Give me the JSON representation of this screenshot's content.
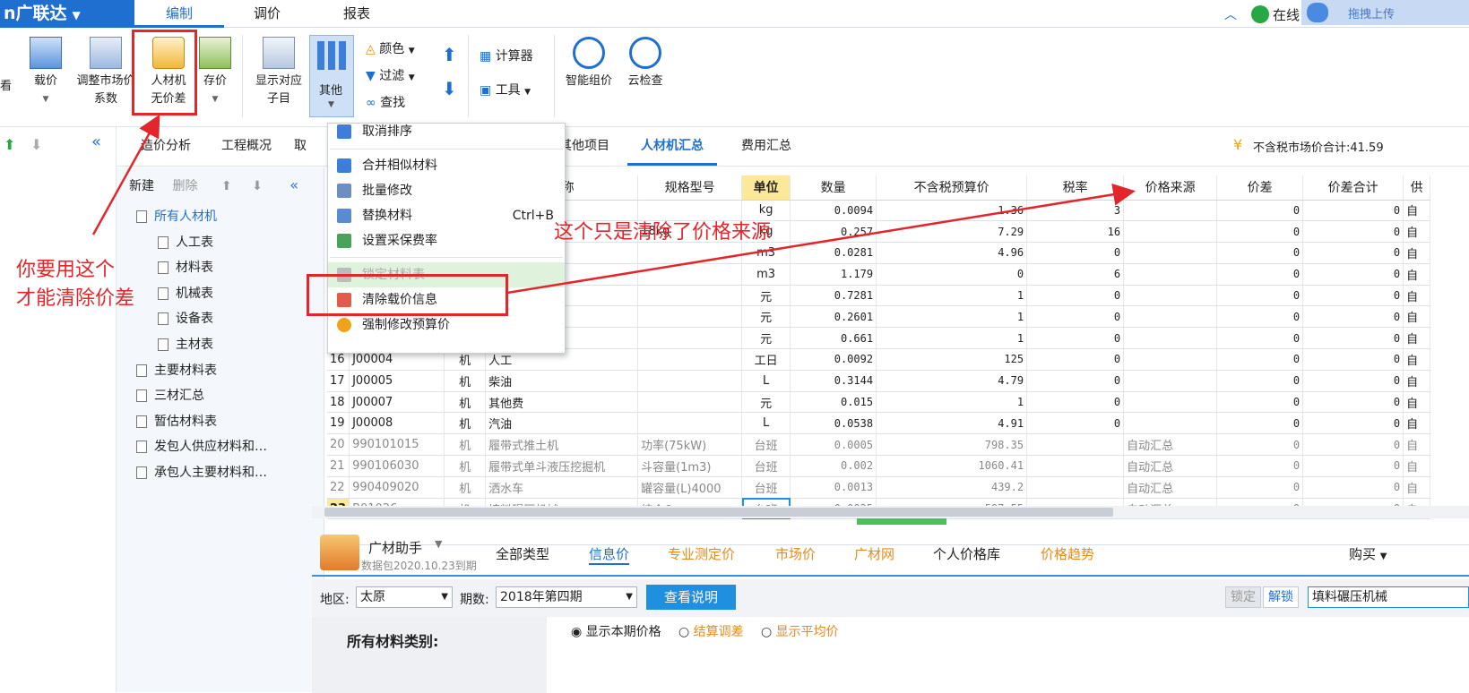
{
  "app": {
    "logo_text": "n广联达",
    "logo_caret": "▼"
  },
  "menu_tabs": [
    "编制",
    "调价",
    "报表"
  ],
  "top_right": {
    "status": "在线",
    "upload": "拖拽上传"
  },
  "ribbon": {
    "view_label": "看",
    "load_price": "载价",
    "adjust_market_line1": "调整市场价",
    "adjust_market_line2": "系数",
    "no_diff_line1": "人材机",
    "no_diff_line2": "无价差",
    "save_price": "存价",
    "show_sub_line1": "显示对应",
    "show_sub_line2": "子目",
    "other": "其他",
    "color": "颜色",
    "filter": "过滤",
    "find": "查找",
    "calculator": "计算器",
    "tools": "工具",
    "smart_price": "智能组价",
    "cloud_check": "云检查"
  },
  "subtabs": [
    "造价分析",
    "工程概况",
    "取",
    "其他项目",
    "人材机汇总",
    "费用汇总"
  ],
  "market_total": "不含税市场价合计:41.59",
  "tree": {
    "new": "新建",
    "delete": "删除",
    "items": [
      {
        "label": "所有人材机",
        "level": 0
      },
      {
        "label": "人工表",
        "level": 1
      },
      {
        "label": "材料表",
        "level": 1
      },
      {
        "label": "机械表",
        "level": 1
      },
      {
        "label": "设备表",
        "level": 1
      },
      {
        "label": "主材表",
        "level": 1
      },
      {
        "label": "主要材料表",
        "level": 0
      },
      {
        "label": "三材汇总",
        "level": 0
      },
      {
        "label": "暂估材料表",
        "level": 0
      },
      {
        "label": "发包人供应材料和…",
        "level": 0
      },
      {
        "label": "承包人主要材料和…",
        "level": 0
      }
    ]
  },
  "grid": {
    "headers": [
      "",
      "编码",
      "类别",
      "名称",
      "规格型号",
      "单位",
      "数量",
      "不含税预算价",
      "税率",
      "价格来源",
      "价差",
      "价差合计",
      "供"
    ],
    "rows": [
      [
        "",
        "",
        "",
        "",
        "",
        "kg",
        "0.0094",
        "1.36",
        "3",
        "",
        "0",
        "0",
        "自"
      ],
      [
        "",
        "",
        "",
        "",
        "18kg",
        "kg",
        "0.257",
        "7.29",
        "16",
        "",
        "0",
        "0",
        "自"
      ],
      [
        "",
        "",
        "",
        "",
        "",
        "m3",
        "0.0281",
        "4.96",
        "0",
        "",
        "0",
        "0",
        "自"
      ],
      [
        "",
        "",
        "",
        "",
        "",
        "m3",
        "1.179",
        "0",
        "6",
        "",
        "0",
        "0",
        "自"
      ],
      [
        "",
        "",
        "",
        "",
        "",
        "元",
        "0.7281",
        "1",
        "0",
        "",
        "0",
        "0",
        "自"
      ],
      [
        "",
        "",
        "",
        "",
        "",
        "元",
        "0.2601",
        "1",
        "0",
        "",
        "0",
        "0",
        "自"
      ],
      [
        "",
        "",
        "",
        "",
        "",
        "元",
        "0.661",
        "1",
        "0",
        "",
        "0",
        "0",
        "自"
      ],
      [
        "16",
        "J00004",
        "机",
        "人工",
        "",
        "工日",
        "0.0092",
        "125",
        "0",
        "",
        "0",
        "0",
        "自"
      ],
      [
        "17",
        "J00005",
        "机",
        "柴油",
        "",
        "L",
        "0.3144",
        "4.79",
        "0",
        "",
        "0",
        "0",
        "自"
      ],
      [
        "18",
        "J00007",
        "机",
        "其他费",
        "",
        "元",
        "0.015",
        "1",
        "0",
        "",
        "0",
        "0",
        "自"
      ],
      [
        "19",
        "J00008",
        "机",
        "汽油",
        "",
        "L",
        "0.0538",
        "4.91",
        "0",
        "",
        "0",
        "0",
        "自"
      ],
      [
        "20",
        "990101015",
        "机",
        "履带式推土机",
        "功率(75kW)",
        "台班",
        "0.0005",
        "798.35",
        "",
        "自动汇总",
        "0",
        "0",
        "自"
      ],
      [
        "21",
        "990106030",
        "机",
        "履带式单斗液压挖掘机",
        "斗容量(1m3)",
        "台班",
        "0.002",
        "1060.41",
        "",
        "自动汇总",
        "0",
        "0",
        "自"
      ],
      [
        "22",
        "990409020",
        "机",
        "洒水车",
        "罐容量(L)4000",
        "台班",
        "0.0013",
        "439.2",
        "",
        "自动汇总",
        "0",
        "0",
        "自"
      ],
      [
        "23",
        "B01026",
        "机",
        "填料碾压机械",
        "综合6",
        "台班",
        "0.0025",
        "597.55",
        "",
        "自动汇总",
        "0",
        "0",
        "自"
      ]
    ]
  },
  "dropdown": {
    "items": [
      {
        "label": "取消排序",
        "shortcut": ""
      },
      {
        "label": "合并相似材料",
        "shortcut": ""
      },
      {
        "label": "批量修改",
        "shortcut": ""
      },
      {
        "label": "替换材料",
        "shortcut": "Ctrl+B"
      },
      {
        "label": "设置采保费率",
        "shortcut": ""
      },
      {
        "label": "锁定材料表",
        "shortcut": ""
      },
      {
        "label": "清除载价信息",
        "shortcut": ""
      },
      {
        "label": "强制修改预算价",
        "shortcut": ""
      }
    ]
  },
  "helper": {
    "title": "广材助手",
    "subtitle": "数据包2020.10.23到期",
    "tabs": [
      "全部类型",
      "信息价",
      "专业测定价",
      "市场价",
      "广材网",
      "个人价格库",
      "价格趋势"
    ],
    "buy": "购买",
    "region_label": "地区:",
    "region_value": "太原",
    "period_label": "期数:",
    "period_value": "2018年第四期",
    "explain_btn": "查看说明",
    "lock": "锁定",
    "unlock": "解锁",
    "search_value": "填料碾压机械",
    "all_categories": "所有材料类别:",
    "radio1": "显示本期价格",
    "radio2": "结算调差",
    "radio3": "显示平均价"
  },
  "annotations": {
    "left_line1": "你要用这个",
    "left_line2": "才能清除价差",
    "middle": "这个只是清除了价格来源"
  },
  "colors": {
    "brand": "#1f6fd0",
    "annotation": "#e3262c",
    "orange": "#e98a1c"
  }
}
